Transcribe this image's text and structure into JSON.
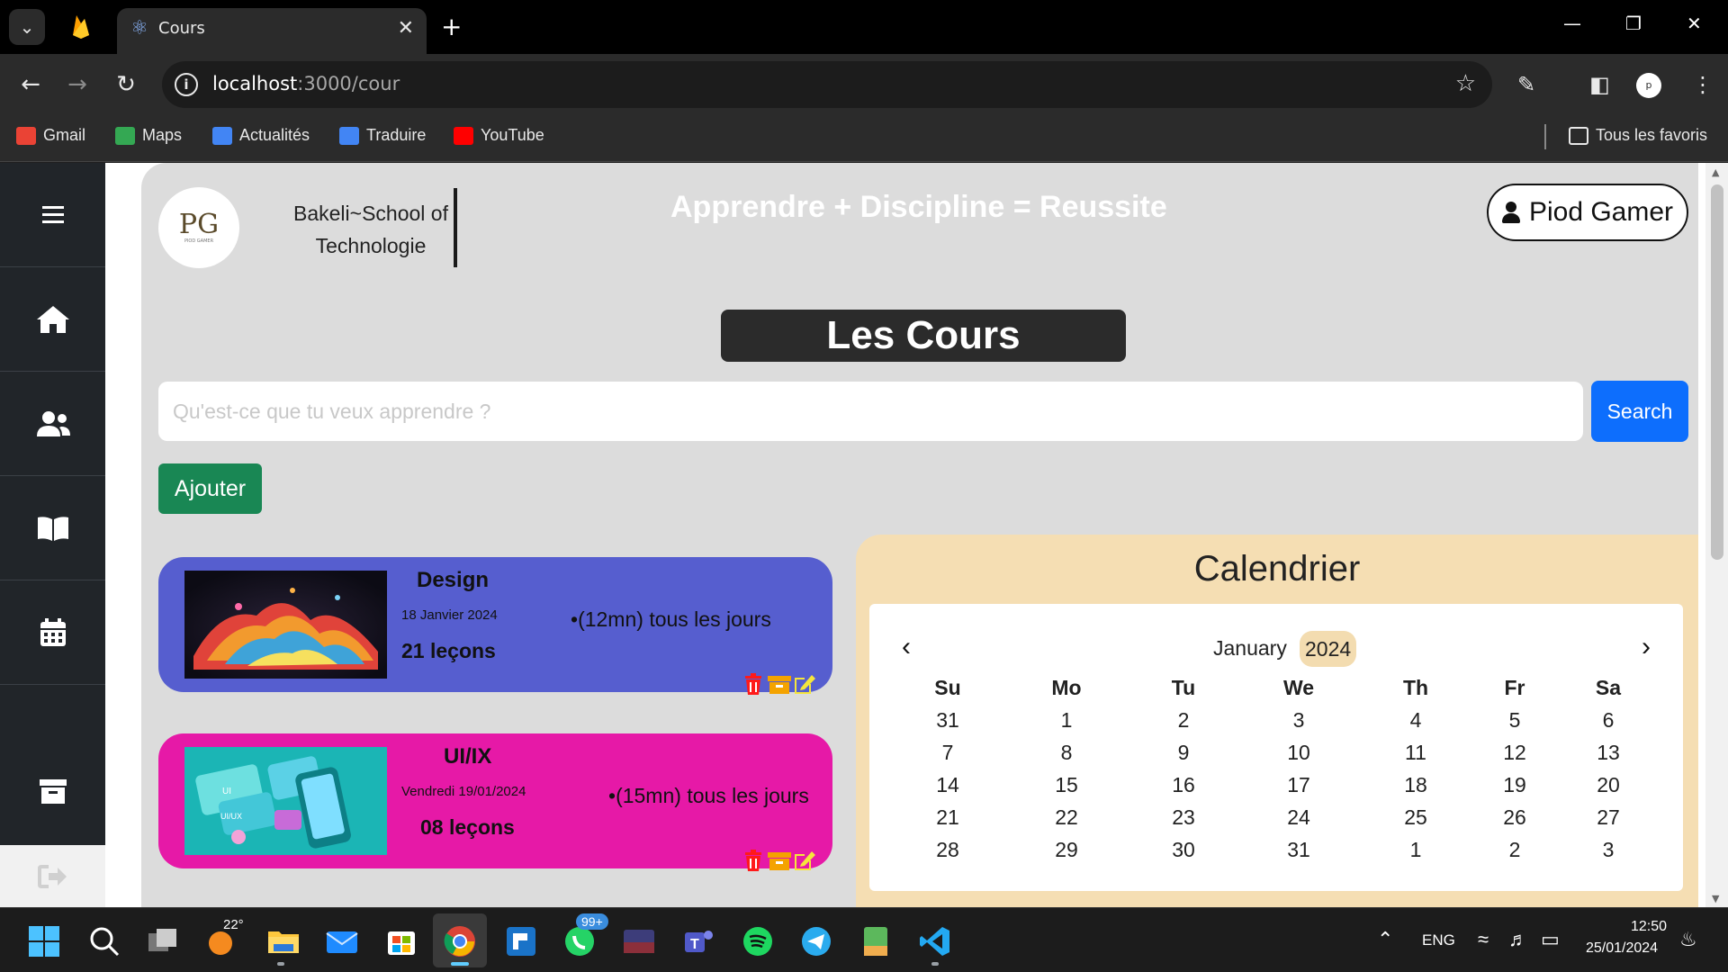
{
  "browser": {
    "tab_title": "Cours",
    "url_host": "localhost",
    "url_path": ":3000/cour",
    "profile_initials": "p",
    "bookmarks": [
      {
        "label": "Gmail",
        "icon": "gmail-icon",
        "color": "#ea4335"
      },
      {
        "label": "Maps",
        "icon": "maps-icon",
        "color": "#34a853"
      },
      {
        "label": "Actualités",
        "icon": "news-icon",
        "color": "#4285f4"
      },
      {
        "label": "Traduire",
        "icon": "translate-icon",
        "color": "#4285f4"
      },
      {
        "label": "YouTube",
        "icon": "youtube-icon",
        "color": "#ff0000"
      }
    ],
    "all_bookmarks_label": "Tous les favoris"
  },
  "header": {
    "logo_text": "PG",
    "logo_sub": "PIOD GAMER",
    "school_name": "Bakeli~School of Technologie",
    "motto": "Apprendre + Discipline = Reussite",
    "user_name": "Piod Gamer"
  },
  "sidebar": {
    "items": [
      {
        "name": "menu",
        "icon": "hamburger-icon"
      },
      {
        "name": "home",
        "icon": "home-icon"
      },
      {
        "name": "users",
        "icon": "users-icon"
      },
      {
        "name": "courses",
        "icon": "book-icon"
      },
      {
        "name": "calendar",
        "icon": "calendar-icon"
      },
      {
        "name": "archive",
        "icon": "archive-icon"
      },
      {
        "name": "logout",
        "icon": "logout-icon"
      }
    ]
  },
  "main": {
    "title": "Les Cours",
    "search_placeholder": "Qu'est-ce que tu veux apprendre ?",
    "search_label": "Search",
    "add_label": "Ajouter"
  },
  "courses": [
    {
      "name": "Design",
      "date": "18 Janvier 2024",
      "lessons": "21 leçons",
      "duration": "(12mn)",
      "frequency": "tous les jours",
      "color": "#565ecf"
    },
    {
      "name": "UI/IX",
      "date": "Vendredi 19/01/2024",
      "lessons": "08 leçons",
      "duration": "(15mn)",
      "frequency": "tous les jours",
      "color": "#e619a7"
    }
  ],
  "calendar": {
    "title": "Calendrier",
    "month": "January",
    "year": "2024",
    "weekdays": [
      "Su",
      "Mo",
      "Tu",
      "We",
      "Th",
      "Fr",
      "Sa"
    ],
    "weeks": [
      [
        "31",
        "1",
        "2",
        "3",
        "4",
        "5",
        "6"
      ],
      [
        "7",
        "8",
        "9",
        "10",
        "11",
        "12",
        "13"
      ],
      [
        "14",
        "15",
        "16",
        "17",
        "18",
        "19",
        "20"
      ],
      [
        "21",
        "22",
        "23",
        "24",
        "25",
        "26",
        "27"
      ],
      [
        "28",
        "29",
        "30",
        "31",
        "1",
        "2",
        "3"
      ]
    ]
  },
  "taskbar": {
    "weather_temp": "22°",
    "whatsapp_badge": "99+",
    "language": "ENG",
    "time": "12:50",
    "date": "25/01/2024"
  }
}
